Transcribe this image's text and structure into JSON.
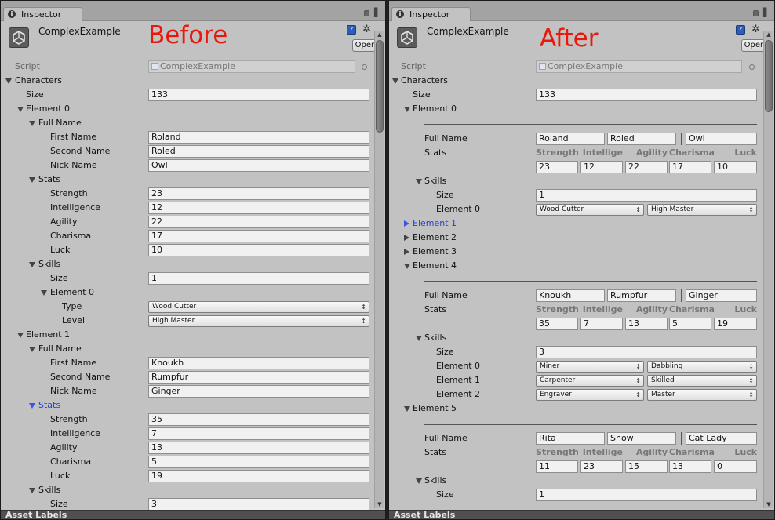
{
  "left": {
    "tab": "Inspector",
    "object_name": "ComplexExample",
    "big_title": "Before",
    "open_label": "Open",
    "footer": "Asset Labels",
    "script": {
      "label": "Script",
      "value": "ComplexExample"
    },
    "characters": {
      "label": "Characters",
      "size_label": "Size",
      "size_value": "133",
      "element0": {
        "label": "Element 0",
        "full_name": {
          "label": "Full Name",
          "first": {
            "label": "First Name",
            "value": "Roland"
          },
          "second": {
            "label": "Second Name",
            "value": "Roled"
          },
          "nick": {
            "label": "Nick Name",
            "value": "Owl"
          }
        },
        "stats": {
          "label": "Stats",
          "strength": {
            "label": "Strength",
            "value": "23"
          },
          "intelligence": {
            "label": "Intelligence",
            "value": "12"
          },
          "agility": {
            "label": "Agility",
            "value": "22"
          },
          "charisma": {
            "label": "Charisma",
            "value": "17"
          },
          "luck": {
            "label": "Luck",
            "value": "10"
          }
        },
        "skills": {
          "label": "Skills",
          "size_label": "Size",
          "size_value": "1",
          "element0": {
            "label": "Element 0",
            "type": {
              "label": "Type",
              "value": "Wood Cutter"
            },
            "level": {
              "label": "Level",
              "value": "High Master"
            }
          }
        }
      },
      "element1": {
        "label": "Element 1",
        "full_name": {
          "label": "Full Name",
          "first": {
            "label": "First Name",
            "value": "Knoukh"
          },
          "second": {
            "label": "Second Name",
            "value": "Rumpfur"
          },
          "nick": {
            "label": "Nick Name",
            "value": "Ginger"
          }
        },
        "stats": {
          "label": "Stats",
          "strength": {
            "label": "Strength",
            "value": "35"
          },
          "intelligence": {
            "label": "Intelligence",
            "value": "7"
          },
          "agility": {
            "label": "Agility",
            "value": "13"
          },
          "charisma": {
            "label": "Charisma",
            "value": "5"
          },
          "luck": {
            "label": "Luck",
            "value": "19"
          }
        },
        "skills": {
          "label": "Skills",
          "size_label": "Size",
          "size_value": "3"
        }
      }
    }
  },
  "right": {
    "tab": "Inspector",
    "object_name": "ComplexExample",
    "big_title": "After",
    "open_label": "Open",
    "footer": "Asset Labels",
    "script": {
      "label": "Script",
      "value": "ComplexExample"
    },
    "characters": {
      "label": "Characters",
      "size_label": "Size",
      "size_value": "133"
    },
    "stat_headers": [
      "Strength",
      "Intellige",
      "Agility",
      "Charisma",
      "Luck"
    ],
    "full_name_label": "Full Name",
    "stats_label": "Stats",
    "skills_label": "Skills",
    "size_label": "Size",
    "elements": [
      {
        "label": "Element 0",
        "names": [
          "Roland",
          "Roled",
          "Owl"
        ],
        "stats": [
          "23",
          "12",
          "22",
          "17",
          "10"
        ],
        "skills_size": "1",
        "skills": [
          {
            "label": "Element 0",
            "type": "Wood Cutter",
            "level": "High Master"
          }
        ]
      },
      {
        "label": "Element 1"
      },
      {
        "label": "Element 2"
      },
      {
        "label": "Element 3"
      },
      {
        "label": "Element 4",
        "names": [
          "Knoukh",
          "Rumpfur",
          "Ginger"
        ],
        "stats": [
          "35",
          "7",
          "13",
          "5",
          "19"
        ],
        "skills_size": "3",
        "skills": [
          {
            "label": "Element 0",
            "type": "Miner",
            "level": "Dabbling"
          },
          {
            "label": "Element 1",
            "type": "Carpenter",
            "level": "Skilled"
          },
          {
            "label": "Element 2",
            "type": "Engraver",
            "level": "Master"
          }
        ]
      },
      {
        "label": "Element 5",
        "names": [
          "Rita",
          "Snow",
          "Cat Lady"
        ],
        "stats": [
          "11",
          "23",
          "15",
          "13",
          "0"
        ],
        "skills_size": "1"
      }
    ]
  },
  "colors": {
    "accent_title": "#e8180c",
    "selected_blue": "#2342d9",
    "panel_bg": "#c2c2c2"
  }
}
